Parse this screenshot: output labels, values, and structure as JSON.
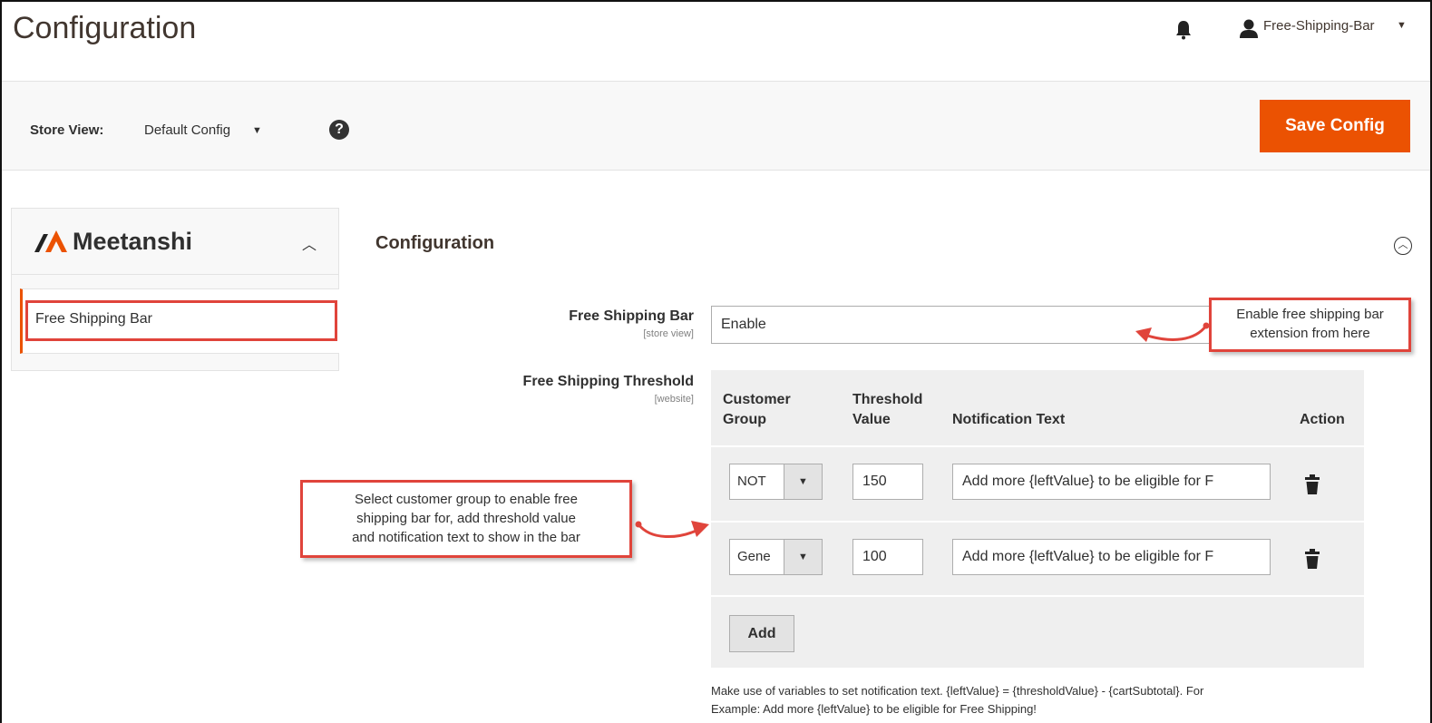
{
  "header": {
    "title": "Configuration",
    "user_name": "Free-Shipping-Bar",
    "icons": [
      "bell-icon",
      "user-icon",
      "caret-down-icon"
    ]
  },
  "store_bar": {
    "label": "Store View:",
    "selected": "Default Config",
    "help": "?",
    "save_label": "Save Config"
  },
  "sidebar": {
    "brand": "Meetanshi",
    "items": [
      {
        "label": "Free Shipping Bar"
      }
    ]
  },
  "section": {
    "title": "Configuration",
    "fields": {
      "enable": {
        "label": "Free Shipping Bar",
        "scope": "[store view]",
        "value": "Enable"
      },
      "threshold": {
        "label": "Free Shipping Threshold",
        "scope": "[website]"
      }
    },
    "grid": {
      "headers": {
        "group_line1": "Customer",
        "group_line2": "Group",
        "threshold_line1": "Threshold",
        "threshold_line2": "Value",
        "text": "Notification Text",
        "action": "Action"
      },
      "rows": [
        {
          "group": "NOT",
          "value": "150",
          "text": "Add more {leftValue} to be eligible for F"
        },
        {
          "group": "Gene",
          "value": "100",
          "text": "Add more {leftValue} to be eligible for F"
        }
      ],
      "add_label": "Add"
    },
    "note_line1": "Make use of variables to set notification text. {leftValue} = {thresholdValue} - {cartSubtotal}. For",
    "note_line2": "Example: Add more {leftValue} to be eligible for Free Shipping!"
  },
  "callouts": {
    "enable_line1": "Enable free shipping bar",
    "enable_line2": "extension from here",
    "group_line1": "Select customer group to enable free",
    "group_line2": "shipping bar for, add threshold value",
    "group_line3": "and notification text to show in the bar"
  },
  "colors": {
    "accent": "#eb5202",
    "callout_border": "#e0443b"
  }
}
